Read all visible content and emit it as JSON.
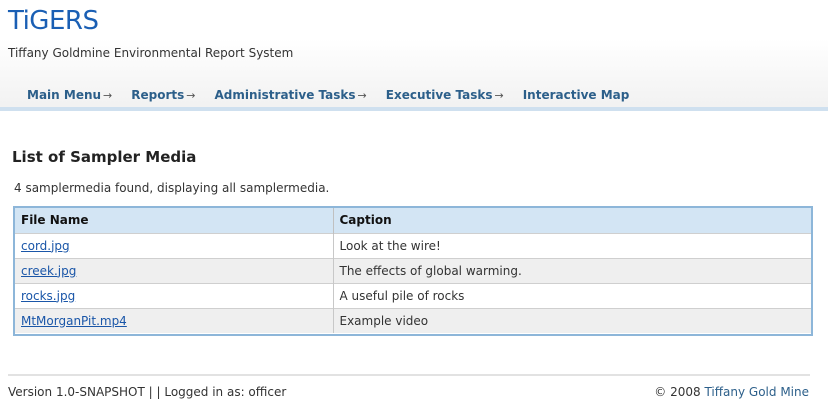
{
  "header": {
    "logo": "TiGERS",
    "subtitle": "Tiffany Goldmine Environmental Report System"
  },
  "nav": {
    "items": [
      {
        "label": "Main Menu",
        "arrow": "→"
      },
      {
        "label": "Reports",
        "arrow": "→"
      },
      {
        "label": "Administrative Tasks",
        "arrow": "→"
      },
      {
        "label": "Executive Tasks",
        "arrow": "→"
      },
      {
        "label": "Interactive Map",
        "arrow": ""
      }
    ]
  },
  "main": {
    "title": "List of Sampler Media",
    "summary": "4 samplermedia found, displaying all samplermedia.",
    "table": {
      "headers": [
        "File Name",
        "Caption"
      ],
      "rows": [
        {
          "file": "cord.jpg",
          "caption": "Look at the wire!"
        },
        {
          "file": "creek.jpg",
          "caption": "The effects of global warming."
        },
        {
          "file": "rocks.jpg",
          "caption": "A useful pile of rocks"
        },
        {
          "file": "MtMorganPit.mp4",
          "caption": "Example video"
        }
      ]
    }
  },
  "footer": {
    "version": "Version 1.0-SNAPSHOT | | Logged in as: officer",
    "copyright": "© 2008",
    "company": "Tiffany Gold Mine"
  },
  "colors": {
    "brand": "#1a5fb4",
    "nav_text": "#2c5f8a",
    "table_header_bg": "#d3e5f4",
    "table_border": "#8db6d9",
    "link": "#1a56a8"
  }
}
